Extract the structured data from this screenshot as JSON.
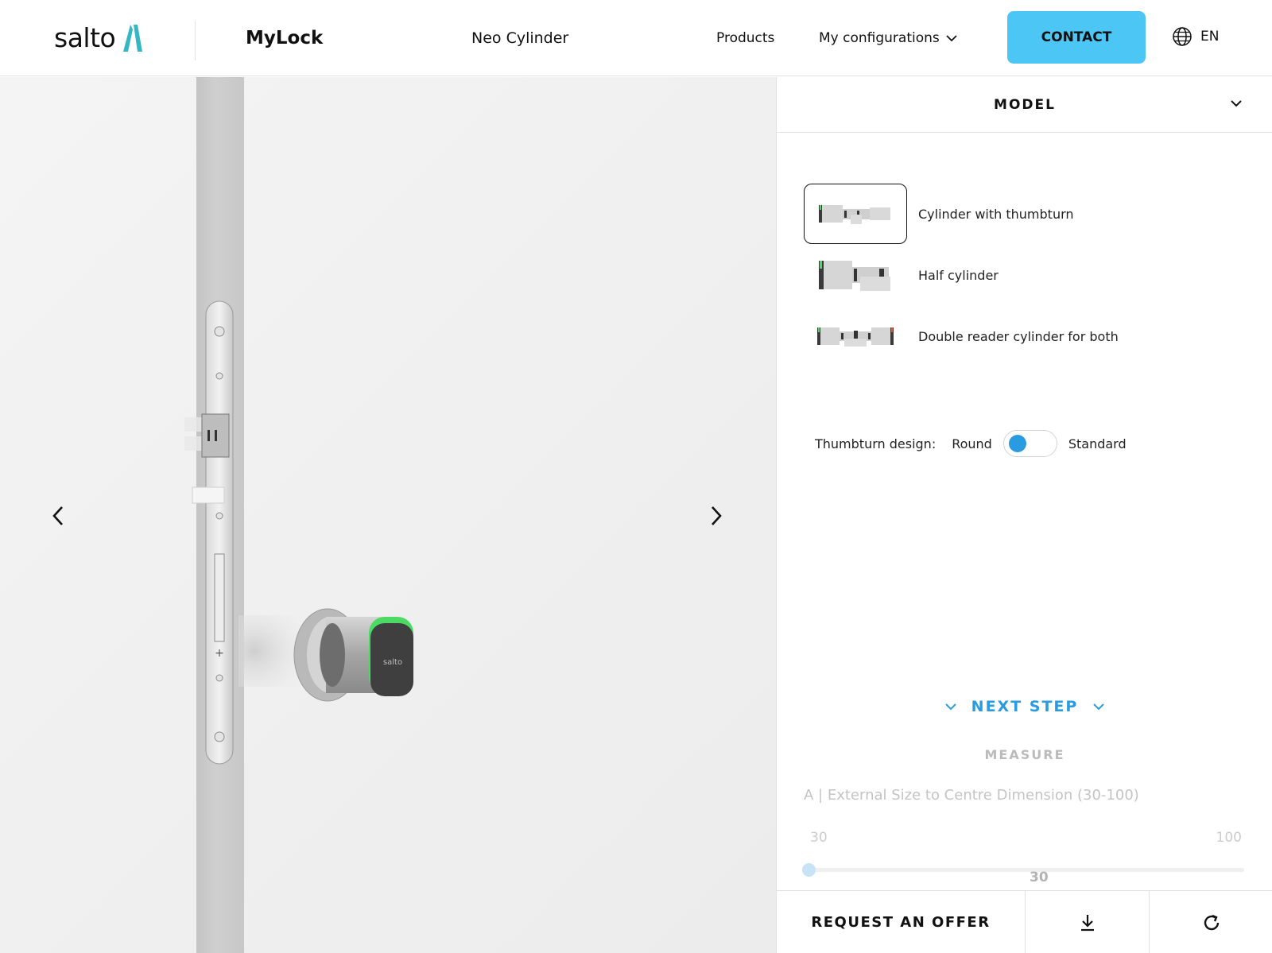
{
  "header": {
    "logo_text": "salto",
    "brand": "MyLock",
    "product": "Neo Cylinder",
    "nav": {
      "products": "Products",
      "configurations": "My configurations"
    },
    "contact_label": "CONTACT",
    "language": "EN"
  },
  "colors": {
    "accent": "#4bc6f5",
    "accent_dark": "#2a9be0",
    "logo_teal": "#35b6c3",
    "led_green": "#4cd964"
  },
  "viewer": {
    "prev_icon": "chevron-left-icon",
    "next_icon": "chevron-right-icon",
    "device_brand": "salto"
  },
  "panel": {
    "section_title": "MODEL",
    "models": [
      {
        "label": "Cylinder with thumbturn",
        "selected": true
      },
      {
        "label": "Half cylinder",
        "selected": false
      },
      {
        "label": "Double reader cylinder for both",
        "selected": false
      }
    ],
    "thumbturn": {
      "label": "Thumbturn design:",
      "option_left": "Round",
      "option_right": "Standard"
    },
    "next_step": "NEXT STEP",
    "measure": {
      "title": "MEASURE",
      "label": "A | External Size to Centre Dimension (30-100)",
      "min": "30",
      "max": "100",
      "value": "30"
    },
    "actions": {
      "request_offer": "REQUEST AN OFFER",
      "download_icon": "download-icon",
      "reset_icon": "refresh-icon"
    }
  }
}
